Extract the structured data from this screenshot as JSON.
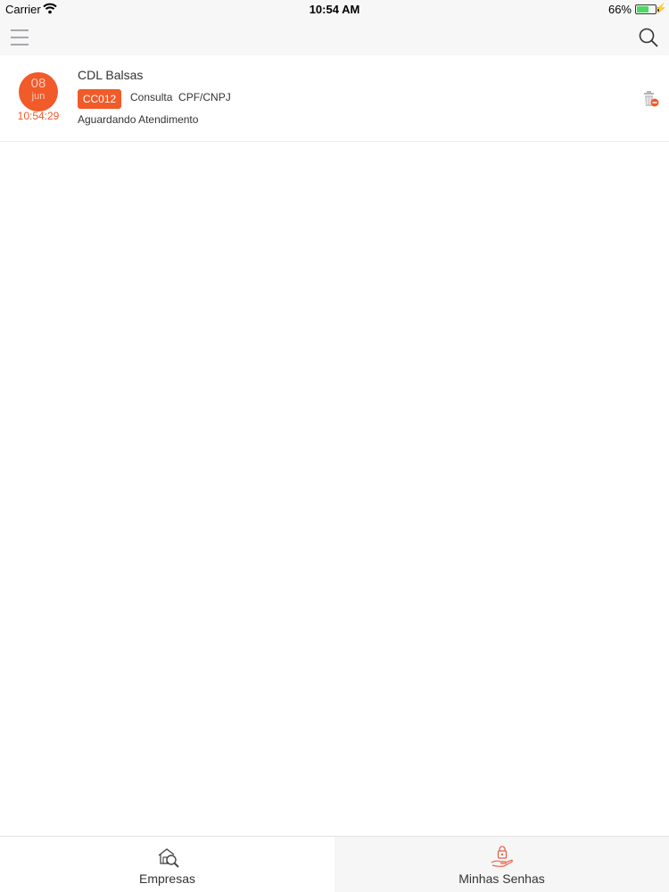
{
  "status_bar": {
    "carrier": "Carrier",
    "time": "10:54 AM",
    "battery_percent": "66%",
    "battery_level": 0.66,
    "wifi_icon": "wifi-icon",
    "battery_icon": "battery-charging-icon"
  },
  "nav": {
    "menu_icon": "hamburger-menu-icon",
    "search_icon": "search-icon"
  },
  "tickets": [
    {
      "day": "08",
      "month": "jun",
      "time": "10:54:29",
      "company": "CDL Balsas",
      "code": "CC012",
      "service": "Consulta  CPF/CNPJ",
      "status": "Aguardando Atendimento",
      "delete_icon": "trash-icon"
    }
  ],
  "tab_bar": {
    "tabs": [
      {
        "label": "Empresas",
        "icon": "company-search-icon",
        "selected": false
      },
      {
        "label": "Minhas Senhas",
        "icon": "hand-lock-icon",
        "selected": true
      }
    ]
  },
  "colors": {
    "accent": "#f15a29",
    "nav_background": "#f7f7f8",
    "selected_tab_background": "#f6f6f7"
  }
}
